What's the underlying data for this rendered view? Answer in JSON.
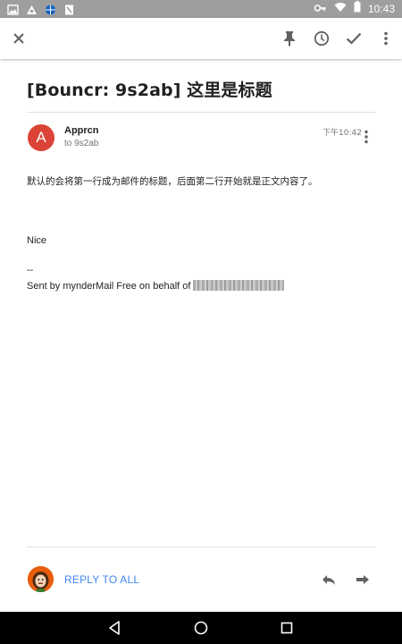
{
  "status_bar": {
    "time": "10:43",
    "left_icons": [
      "image-icon",
      "app-icon",
      "browser-icon",
      "newspaper-icon"
    ],
    "right_icons": [
      "key-icon",
      "wifi-icon",
      "battery-icon"
    ]
  },
  "toolbar": {
    "close_icon": "close-icon",
    "actions": [
      "pin-icon",
      "snooze-clock-icon",
      "done-check-icon",
      "more-vert-icon"
    ]
  },
  "email": {
    "subject": "[Bouncr: 9s2ab] 这里是标题",
    "sender": {
      "avatar_letter": "A",
      "name": "Apprcn",
      "to": "to 9s2ab",
      "time": "下午10:42"
    },
    "body": {
      "line1": "默认的会将第一行成为邮件的标题，后面第二行开始就是正文内容了。",
      "line2": "Nice",
      "line3": "--",
      "line4": "Sent by mynderMail Free on behalf of"
    }
  },
  "reply_bar": {
    "reply_all_label": "REPLY TO ALL",
    "reply_icon": "reply-icon",
    "forward_icon": "forward-icon"
  },
  "colors": {
    "status_bar": "#9e9e9e",
    "avatar": "#db4437",
    "accent": "#4285f4",
    "nav_bar": "#000000"
  }
}
